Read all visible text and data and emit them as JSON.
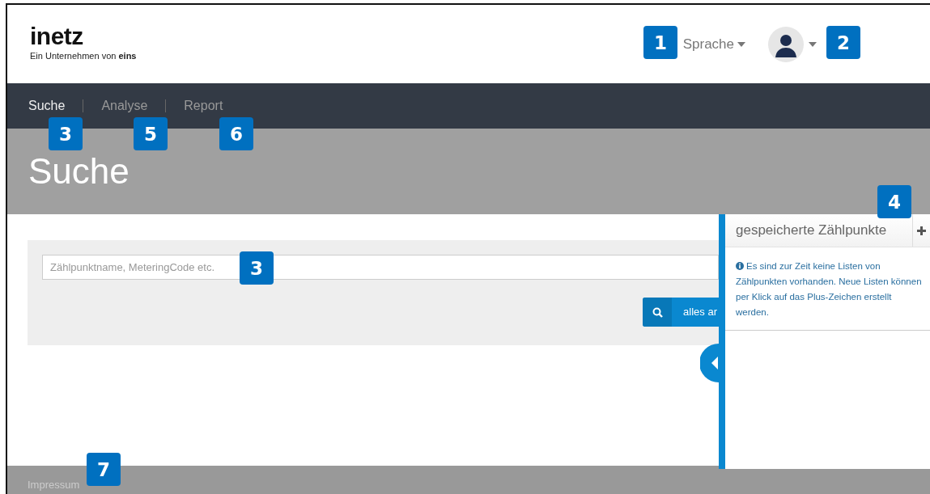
{
  "header": {
    "logo": {
      "name": "inetz",
      "tagline": "Ein Unternehmen von **eins**"
    },
    "language_menu": {
      "label": "Sprache"
    }
  },
  "nav": {
    "tabs": [
      {
        "label": "Suche",
        "selected": true
      },
      {
        "label": "Analyse",
        "selected": false
      },
      {
        "label": "Report",
        "selected": false
      }
    ]
  },
  "page_title": "Suche",
  "search": {
    "placeholder": "Zählpunktname, MeteringCode etc.",
    "button": "alles ar"
  },
  "saved_panel": {
    "title": "gespeicherte Zählpunkte",
    "message": "Es sind zur Zeit keine Listen von Zählpunkten vorhanden. Neue Listen können per Klick auf das Plus-Zeichen erstellt werden."
  },
  "footer": {
    "link": "Impressum"
  },
  "callouts": [
    {
      "number": "1"
    },
    {
      "number": "2"
    },
    {
      "number": "3"
    },
    {
      "number": "5"
    },
    {
      "number": "6"
    },
    {
      "number": "4"
    },
    {
      "number": "3"
    },
    {
      "number": "7"
    }
  ]
}
